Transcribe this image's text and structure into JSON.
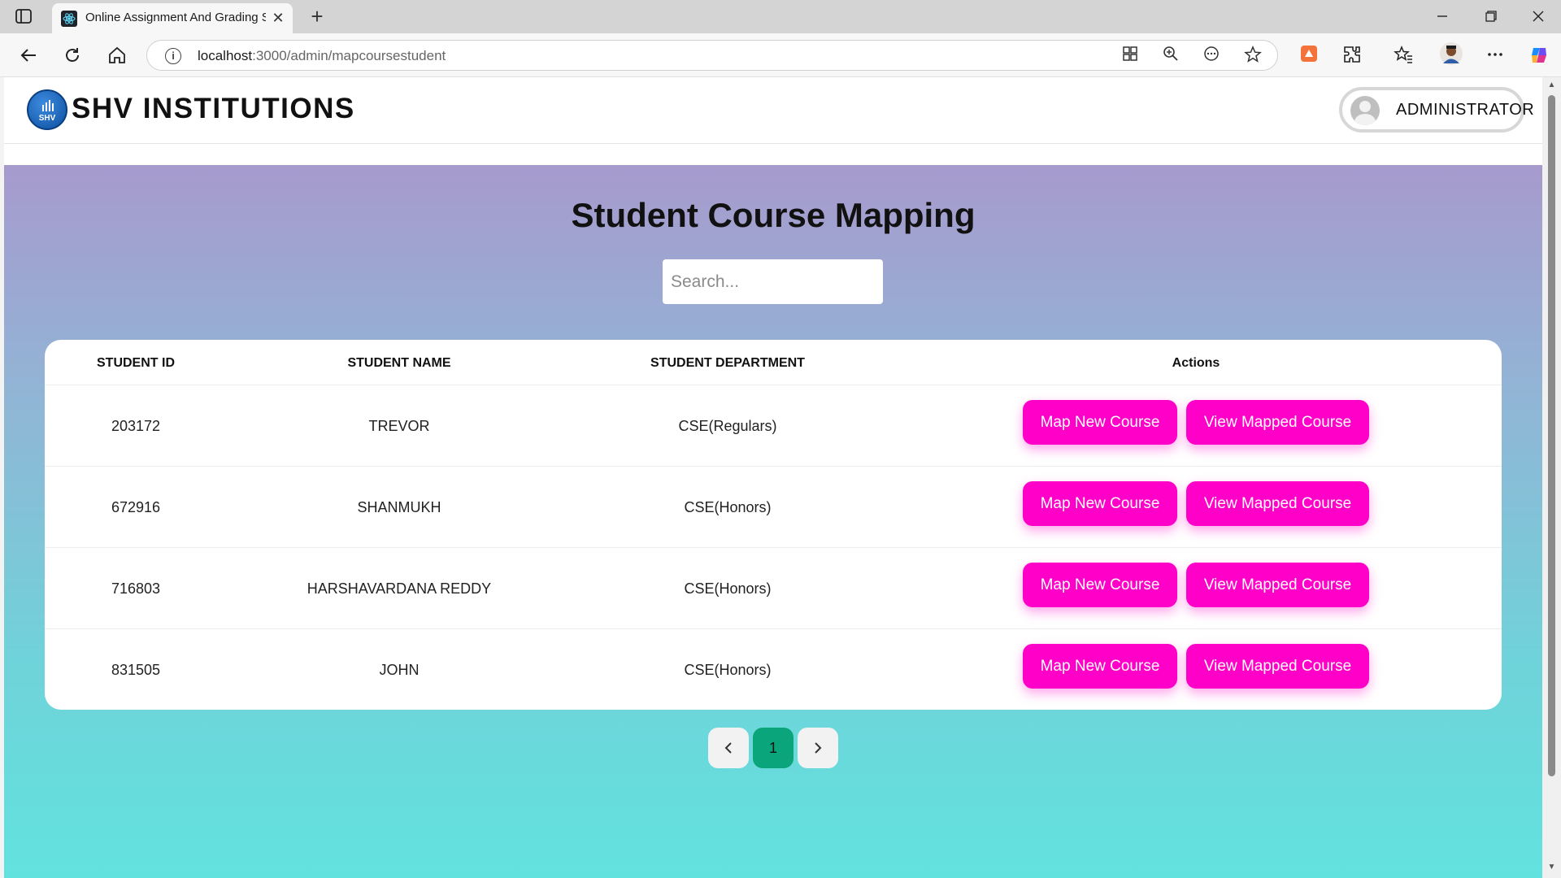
{
  "browser": {
    "tab_title": "Online Assignment And Grading S",
    "url_host": "localhost",
    "url_path": ":3000/admin/mapcoursestudent",
    "close_glyph": "✕",
    "new_tab_glyph": "+",
    "icons": [
      "sidebar-toggle-icon",
      "react-favicon",
      "back-icon",
      "refresh-icon",
      "home-icon",
      "info-icon",
      "app-available-icon",
      "zoom-icon",
      "read-aloud-icon",
      "favorite-icon",
      "extension-icon",
      "extensions-icon",
      "favorites-icon",
      "profile-icon",
      "more-icon",
      "copilot-icon"
    ]
  },
  "header": {
    "brand": "SHV INSTITUTIONS",
    "logo_text": "SHV",
    "user_label": "ADMINISTRATOR"
  },
  "main": {
    "title": "Student Course Mapping",
    "search_placeholder": "Search...",
    "columns": [
      "STUDENT ID",
      "STUDENT NAME",
      "STUDENT DEPARTMENT",
      "Actions"
    ],
    "rows": [
      {
        "id": "203172",
        "name": "TREVOR",
        "department": "CSE(Regulars)"
      },
      {
        "id": "672916",
        "name": "SHANMUKH",
        "department": "CSE(Honors)"
      },
      {
        "id": "716803",
        "name": "HARSHAVARDANA REDDY",
        "department": "CSE(Honors)"
      },
      {
        "id": "831505",
        "name": "JOHN",
        "department": "CSE(Honors)"
      }
    ],
    "map_label": "Map New Course",
    "view_label": "View Mapped Course",
    "pagination": {
      "prev": "‹",
      "current": "1",
      "next": "›"
    }
  },
  "colors": {
    "action_button": "#ff00c8",
    "active_page": "#0aa57a",
    "gradient_top": "#a79acd",
    "gradient_bottom": "#62e2df"
  }
}
